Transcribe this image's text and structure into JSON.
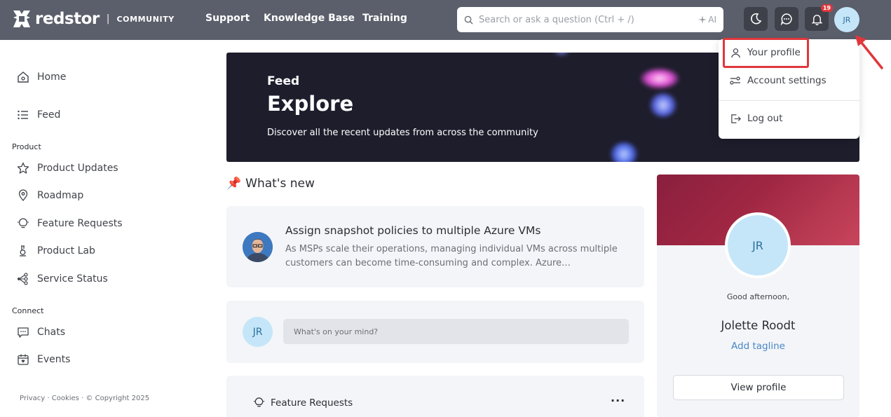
{
  "header": {
    "logo_text": "redstor",
    "logo_separator": "|",
    "logo_sub": "COMMUNITY",
    "nav": [
      "Support",
      "Knowledge Base",
      "Training"
    ],
    "search_placeholder": "Search or ask a question (Ctrl + /)",
    "ai_label": "AI",
    "notification_count": "19",
    "avatar_initials": "JR"
  },
  "sidebar": {
    "top_items": [
      {
        "label": "Home",
        "icon": "home-icon"
      },
      {
        "label": "Feed",
        "icon": "list-icon"
      }
    ],
    "sections": [
      {
        "title": "Product",
        "items": [
          {
            "label": "Product Updates",
            "icon": "star-icon"
          },
          {
            "label": "Roadmap",
            "icon": "map-pin-icon"
          },
          {
            "label": "Feature Requests",
            "icon": "lightbulb-icon"
          },
          {
            "label": "Product Lab",
            "icon": "flask-icon"
          },
          {
            "label": "Service Status",
            "icon": "nodes-icon"
          }
        ]
      },
      {
        "title": "Connect",
        "items": [
          {
            "label": "Chats",
            "icon": "chat-icon"
          },
          {
            "label": "Events",
            "icon": "calendar-icon"
          }
        ]
      }
    ],
    "footer": "Privacy · Cookies · © Copyright 2025"
  },
  "hero": {
    "kicker": "Feed",
    "title": "Explore",
    "description": "Discover all the recent updates from across the community"
  },
  "whats_new": {
    "emoji": "📌",
    "title": "What's new",
    "post": {
      "title": "Assign snapshot policies to multiple Azure VMs",
      "body": "As MSPs scale their operations, managing individual VMs across multiple customers can become time-consuming and complex. Azure…"
    }
  },
  "composer": {
    "avatar_initials": "JR",
    "placeholder": "What's on your mind?"
  },
  "feature_requests": {
    "label": "Feature Requests",
    "more": "···"
  },
  "profile_card": {
    "initials": "JR",
    "greeting": "Good afternoon,",
    "name": "Jolette Roodt",
    "tagline": "Add tagline",
    "button": "View profile"
  },
  "menu": {
    "items": [
      {
        "label": "Your profile",
        "icon": "user-icon"
      },
      {
        "label": "Account settings",
        "icon": "settings-toggle-icon"
      },
      {
        "label": "Log out",
        "icon": "logout-icon"
      }
    ]
  },
  "colors": {
    "header_bg": "#5b5f6b",
    "hero_bg": "#1e1d2c",
    "accent_blue": "#4a87c6",
    "highlight_red": "#e0373d",
    "avatar_bg": "#c5e6f9"
  }
}
